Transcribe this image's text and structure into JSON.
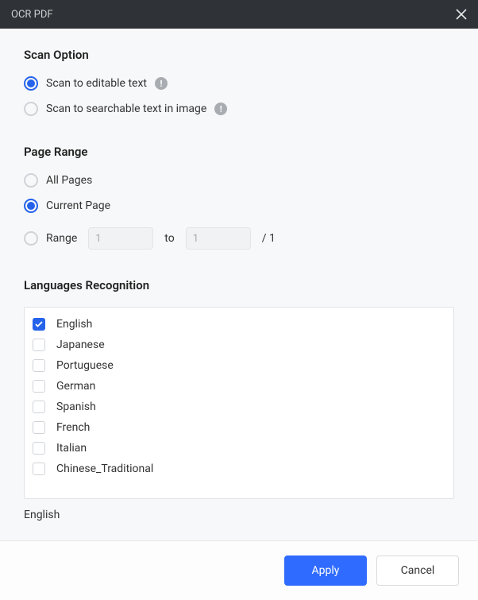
{
  "titlebar": {
    "title": "OCR PDF"
  },
  "scan": {
    "section_title": "Scan Option",
    "option_editable": "Scan to editable text",
    "option_searchable": "Scan to searchable text in image",
    "selected": "editable"
  },
  "page_range": {
    "section_title": "Page Range",
    "all_pages": "All Pages",
    "current_page": "Current Page",
    "range_label": "Range",
    "from_value": "1",
    "to_label": "to",
    "to_value": "1",
    "total_pages": "/ 1",
    "selected": "current"
  },
  "languages": {
    "section_title": "Languages Recognition",
    "items": [
      {
        "label": "English",
        "checked": true
      },
      {
        "label": "Japanese",
        "checked": false
      },
      {
        "label": "Portuguese",
        "checked": false
      },
      {
        "label": "German",
        "checked": false
      },
      {
        "label": "Spanish",
        "checked": false
      },
      {
        "label": "French",
        "checked": false
      },
      {
        "label": "Italian",
        "checked": false
      },
      {
        "label": "Chinese_Traditional",
        "checked": false
      }
    ],
    "selected_summary": "English"
  },
  "footer": {
    "apply": "Apply",
    "cancel": "Cancel"
  }
}
